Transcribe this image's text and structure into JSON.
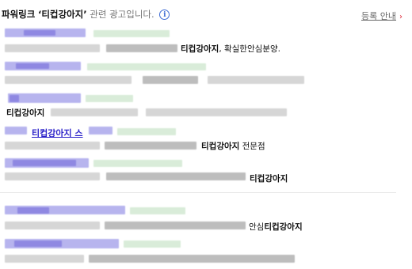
{
  "header": {
    "title_prefix": "파워링크",
    "title_keyword": "‘티컵강아지’",
    "title_suffix": "관련 광고입니다.",
    "info_glyph": "i",
    "register_link": "등록 안내",
    "register_chevron": "›"
  },
  "ads": [
    {
      "keyword": "티컵강아지",
      "text_after": ", 확실한안심분양."
    },
    {
      "keyword": ""
    },
    {
      "keyword": "티컵강아지"
    },
    {
      "link": "티컵강아지 스",
      "keyword": "티컵강아지",
      "text_after": " 전문점"
    },
    {
      "keyword": "티컵강아지"
    },
    {
      "text_before": "안심",
      "keyword": "티컵강아지"
    }
  ],
  "colors": {
    "link": "#2b22c9",
    "info": "#3d6bd4",
    "chevron": "#d23333"
  }
}
